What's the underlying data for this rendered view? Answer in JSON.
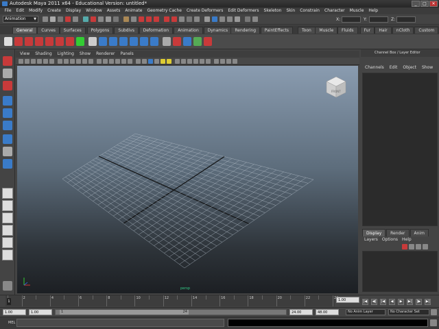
{
  "window": {
    "title": "Autodesk Maya 2011 x64 - Educational Version: untitled*",
    "controls": [
      "_",
      "□",
      "✕"
    ]
  },
  "menubar": [
    "File",
    "Edit",
    "Modify",
    "Create",
    "Display",
    "Window",
    "Assets",
    "Animate",
    "Geometry Cache",
    "Create Deformers",
    "Edit Deformers",
    "Skeleton",
    "Skin",
    "Constrain",
    "Character",
    "Muscle",
    "Help"
  ],
  "statusline": {
    "mode": "Animation",
    "coord_labels": [
      "X:",
      "Y:",
      "Z:"
    ]
  },
  "shelf_tabs": [
    "General",
    "Curves",
    "Surfaces",
    "Polygons",
    "Subdivs",
    "Deformation",
    "Animation",
    "Dynamics",
    "Rendering",
    "PaintEffects",
    "Toon",
    "Muscle",
    "Fluids",
    "Fur",
    "Hair",
    "nCloth",
    "Custom"
  ],
  "viewport": {
    "menu": [
      "View",
      "Shading",
      "Lighting",
      "Show",
      "Renderer",
      "Panels"
    ],
    "view_cube_label": "FRONT",
    "camera_label": "persp",
    "grid_lines": 24
  },
  "channel_box": {
    "header": "Channel Box / Layer Editor",
    "menu": [
      "Channels",
      "Edit",
      "Object",
      "Show"
    ],
    "layer_tabs": [
      "Display",
      "Render",
      "Anim"
    ],
    "layer_menu": [
      "Layers",
      "Options",
      "Help"
    ]
  },
  "time_slider": {
    "tick_labels": [
      "2",
      "4",
      "6",
      "8",
      "10",
      "12",
      "14",
      "16",
      "18",
      "20",
      "22",
      "24"
    ],
    "start": 1,
    "end": 24,
    "current_frame": "1.00",
    "current_tick": "1"
  },
  "range_slider": {
    "start_time": "1.00",
    "playback_start": "1.00",
    "inner_start": "1",
    "inner_end": "24",
    "playback_end": "24.00",
    "end_time": "48.00",
    "anim_layer": "No Anim Layer",
    "character_set": "No Character Set"
  },
  "command_line": {
    "label": "MEL"
  },
  "colors": {
    "accent_red": "#c83a3a",
    "maya_blue": "#3a7bc8",
    "panel": "#444444"
  }
}
